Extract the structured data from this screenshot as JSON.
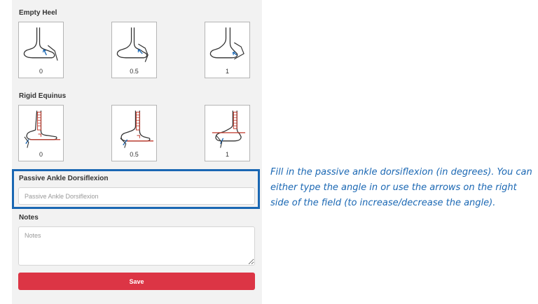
{
  "empty_heel": {
    "title": "Empty Heel",
    "options": [
      {
        "label": "0",
        "icon": "foot-empty-heel-0-icon"
      },
      {
        "label": "0.5",
        "icon": "foot-empty-heel-05-icon"
      },
      {
        "label": "1",
        "icon": "foot-empty-heel-1-icon"
      }
    ]
  },
  "rigid_equinus": {
    "title": "Rigid Equinus",
    "options": [
      {
        "label": "0",
        "icon": "foot-rigid-equinus-0-icon"
      },
      {
        "label": "0.5",
        "icon": "foot-rigid-equinus-05-icon"
      },
      {
        "label": "1",
        "icon": "foot-rigid-equinus-1-icon"
      }
    ]
  },
  "passive_ankle": {
    "title": "Passive Ankle Dorsiflexion",
    "placeholder": "Passive Ankle Dorsiflexion",
    "value": ""
  },
  "notes": {
    "title": "Notes",
    "placeholder": "Notes",
    "value": ""
  },
  "save_label": "Save",
  "callout": "Fill in the passive ankle dorsiflexion (in degrees). You can either type the angle in or use the arrows on the right side of the field (to increase/decrease the angle).",
  "colors": {
    "accent": "#1a67b3",
    "save": "#dc3545",
    "panel": "#f2f2f2",
    "indicator": "#c0392b"
  }
}
